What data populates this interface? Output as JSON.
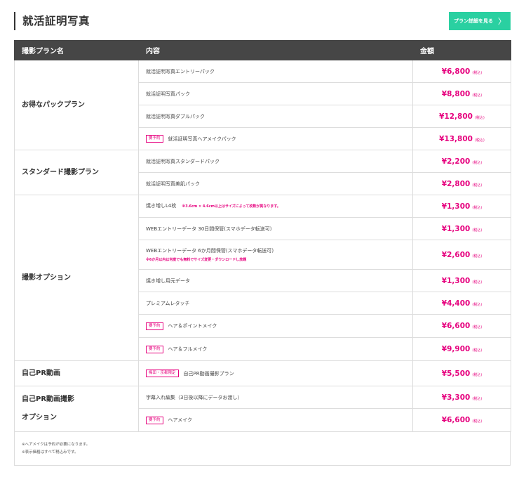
{
  "header": {
    "title": "就活証明写真",
    "plan_button": "プラン詳細を見る",
    "chevron": "〉"
  },
  "columns": [
    "撮影プラン名",
    "内容",
    "金額"
  ],
  "tax_label": "(税込)",
  "reserve_badge": "要予約",
  "groups": [
    {
      "name": "お得なパックプラン",
      "rows": [
        {
          "content": "就活証明写真エントリーパック",
          "price": "¥6,800"
        },
        {
          "content": "就活証明写真パック",
          "price": "¥8,800"
        },
        {
          "content": "就活証明写真ダブルパック",
          "price": "¥12,800"
        },
        {
          "content": "就活証明写真ヘアメイクパック",
          "price": "¥13,800"
        }
      ]
    },
    {
      "name": "スタンダード撮影プラン",
      "rows": [
        {
          "content": "就活証明写真スタンダードパック",
          "price": "¥2,200"
        },
        {
          "content": "就活証明写真美肌パック",
          "price": "¥2,800"
        }
      ]
    },
    {
      "name": "撮影オプション",
      "rows": [
        {
          "content": "焼き増しL4枚",
          "note": "※3.6cm × 4.6cm以上はサイズによって枚数が異なります。",
          "price": "¥1,300"
        },
        {
          "content": "WEBエントリーデータ 30日間保管(スマホデータ転送可)",
          "price": "¥1,300"
        },
        {
          "content": "WEBエントリーデータ 6か月間保管(スマホデータ転送可)",
          "note": "※6か月以内は何度でも無料でサイズ変更・ダウンロードし放題",
          "price": "¥2,600"
        },
        {
          "content": "焼き増し用元データ",
          "price": "¥1,300"
        },
        {
          "content": "プレミアムレタッチ",
          "price": "¥4,400"
        },
        {
          "content": "ヘア＆ポイントメイク",
          "price": "¥6,600"
        },
        {
          "content": "ヘア＆フルメイク",
          "price": "¥9,900"
        }
      ]
    },
    {
      "name": "自己PR動画",
      "rows": [
        {
          "badge": "梅田・京都限定",
          "content": "自己PR動画撮影プラン",
          "price": "¥5,500"
        }
      ]
    },
    {
      "name_line1": "自己PR動画撮影",
      "name_line2": "オプション",
      "rows": [
        {
          "content": "字幕入れ編集（3日後以降にデータお渡し）",
          "price": "¥3,300"
        },
        {
          "content": "ヘアメイク",
          "price": "¥6,600"
        }
      ]
    }
  ],
  "footer": {
    "note1": "※ヘアメイクは予約が必要になります。",
    "note2": "※表示価格はすべて税込みです。"
  }
}
